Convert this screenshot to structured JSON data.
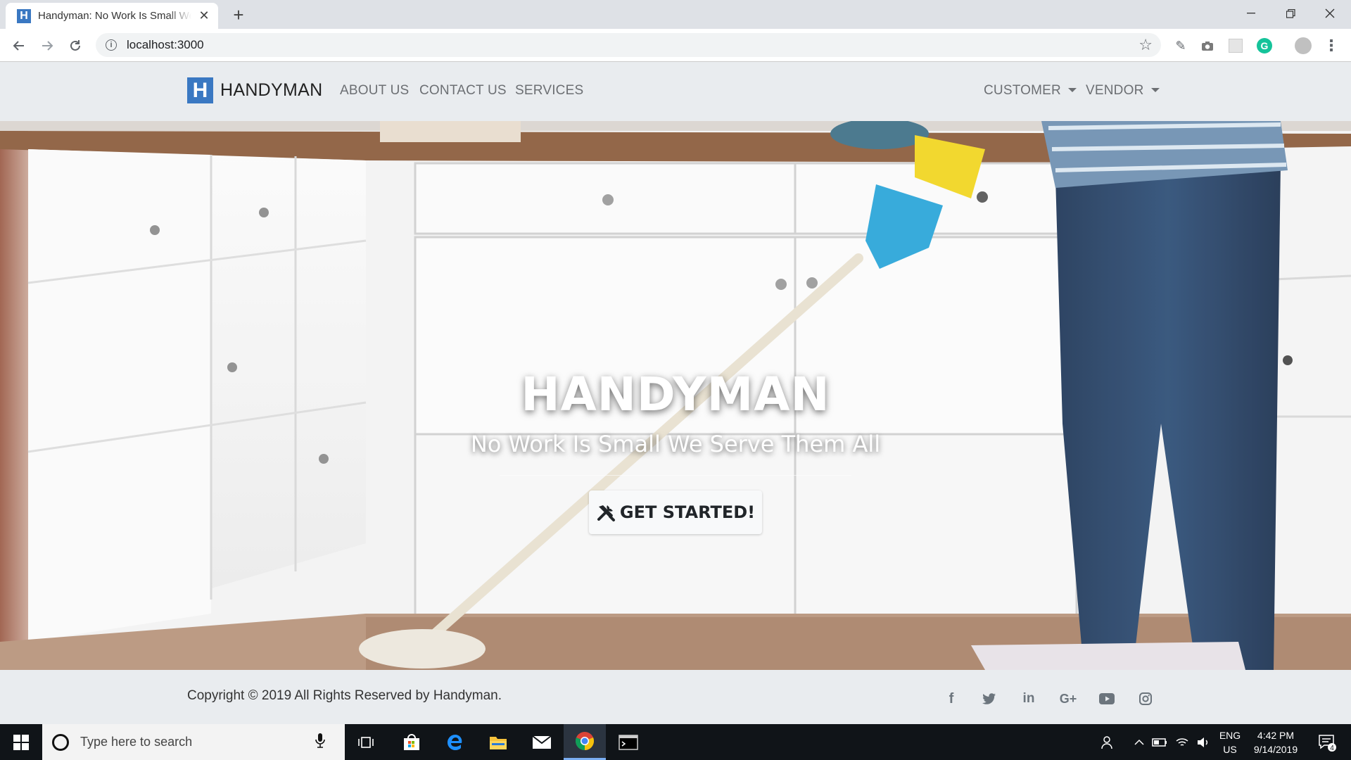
{
  "browser": {
    "tab_title": "Handyman: No Work Is Small We Serve Them All",
    "tab_favicon_letter": "H",
    "url": "localhost:3000",
    "icons": [
      "back-icon",
      "forward-icon",
      "reload-icon",
      "info-icon",
      "star-icon",
      "close-icon",
      "plus-icon"
    ]
  },
  "navbar": {
    "brand_letter": "H",
    "brand": "HANDYMAN",
    "links": [
      "ABOUT US",
      "CONTACT US",
      "SERVICES"
    ],
    "dropdowns": [
      "CUSTOMER",
      "VENDOR"
    ]
  },
  "hero": {
    "title": "HANDYMAN",
    "subtitle": "No Work Is Small We Serve Them All",
    "cta_label": "GET STARTED!",
    "cta_icon": "tools-icon"
  },
  "footer": {
    "copyright": "Copyright © 2019 All Rights Reserved by Handyman.",
    "social": [
      "facebook-icon",
      "twitter-icon",
      "linkedin-icon",
      "google-plus-icon",
      "youtube-icon",
      "instagram-icon"
    ]
  },
  "taskbar": {
    "search_placeholder": "Type here to search",
    "language_line1": "ENG",
    "language_line2": "US",
    "time": "4:42 PM",
    "date": "9/14/2019",
    "notification_count": "4"
  },
  "colors": {
    "brand_blue": "#3a78c2",
    "navbar_bg": "#e9ecef",
    "nav_link": "#6c6f73",
    "taskbar_bg": "#101418"
  }
}
